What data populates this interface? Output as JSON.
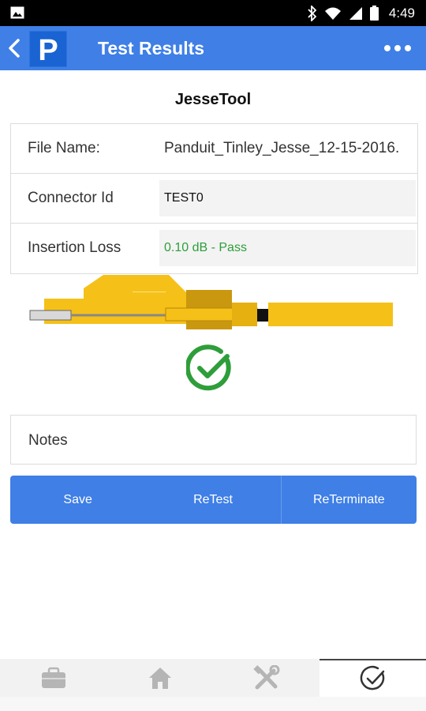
{
  "status_bar": {
    "time": "4:49",
    "icons": [
      "image-icon",
      "bluetooth-icon",
      "wifi-icon",
      "signal-icon",
      "battery-icon"
    ]
  },
  "app_bar": {
    "title": "Test Results",
    "logo_letter": "P",
    "icons": [
      "back-icon",
      "more-icon"
    ]
  },
  "device_title": "JesseTool",
  "info": {
    "file_name_label": "File Name:",
    "file_name_value": "Panduit_Tinley_Jesse_12-15-2016.",
    "connector_id_label": "Connector Id",
    "connector_id_value": "TEST0",
    "insertion_loss_label": "Insertion Loss",
    "insertion_loss_value": "0.10 dB - Pass"
  },
  "result_icon": "check-circle-icon",
  "notes_label": "Notes",
  "actions": {
    "save": "Save",
    "retest": "ReTest",
    "reterminate": "ReTerminate"
  },
  "bottom_nav": {
    "items": [
      "briefcase-icon",
      "home-icon",
      "tools-icon",
      "check-icon"
    ],
    "active": "check-icon"
  },
  "colors": {
    "primary": "#3f7fe6",
    "pass_green": "#2e9e3a",
    "connector_yellow": "#f5c018"
  }
}
